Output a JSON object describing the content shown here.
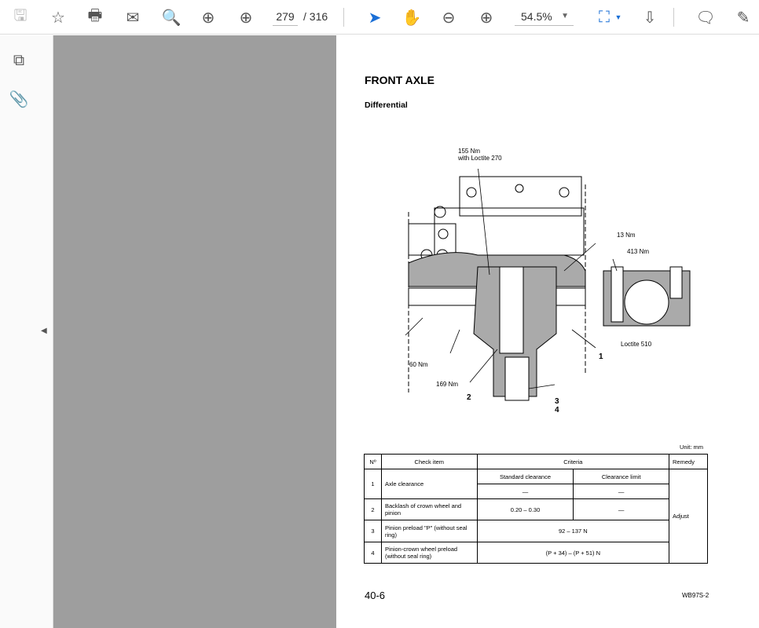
{
  "toolbar": {
    "page_current": "279",
    "page_total": "/ 316",
    "zoom": "54.5%",
    "icons": [
      "save-icon",
      "star-icon",
      "print-icon",
      "email-icon",
      "search-icon",
      "page-up-icon",
      "page-down-icon",
      "select-cursor-icon",
      "hand-icon",
      "zoom-out-icon",
      "zoom-in-icon",
      "fit-page-icon",
      "scroll-mode-icon",
      "comment-icon",
      "highlight-icon"
    ]
  },
  "sidebar": {
    "icons": [
      "pages-icon",
      "attachment-icon"
    ]
  },
  "document": {
    "title": "FRONT AXLE",
    "subtitle": "Differential",
    "diagram_labels": {
      "t155": "155 Nm",
      "loctite270": "with Loctite 270",
      "t13": "13 Nm",
      "t413": "413 Nm",
      "loctite510": "Loctite 510",
      "t60": "60 Nm",
      "t169": "169 Nm",
      "n1": "1",
      "n2": "2",
      "n3": "3",
      "n4": "4"
    },
    "unit": "Unit: mm",
    "table": {
      "headers": {
        "no": "Nº",
        "item": "Check item",
        "criteria": "Criteria",
        "remedy": "Remedy",
        "std": "Standard clearance",
        "limit": "Clearance limit"
      },
      "rows": [
        {
          "no": "1",
          "item": "Axle clearance",
          "std": "—",
          "limit": "—"
        },
        {
          "no": "2",
          "item": "Backlash of crown wheel and pinion",
          "std": "0.20 – 0.30",
          "limit": "—"
        },
        {
          "no": "3",
          "item": "Pinion preload \"P\" (without seal ring)",
          "value": "92 – 137 N"
        },
        {
          "no": "4",
          "item": "Pinion-crown wheel preload (without seal ring)",
          "value": "(P + 34) – (P + 51) N"
        }
      ],
      "remedy": "Adjust"
    },
    "page_number": "40-6",
    "model": "WB97S-2"
  }
}
